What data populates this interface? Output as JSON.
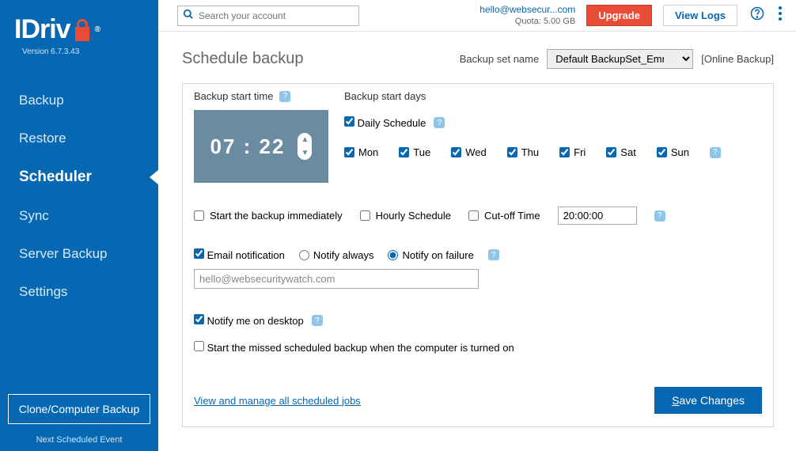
{
  "app": {
    "name": "IDrive",
    "version": "Version  6.7.3.43"
  },
  "sidebar": {
    "items": [
      "Backup",
      "Restore",
      "Scheduler",
      "Sync",
      "Server Backup",
      "Settings"
    ],
    "active_index": 2,
    "clone_label": "Clone/Computer Backup",
    "next_event_label": "Next Scheduled Event"
  },
  "topbar": {
    "search_placeholder": "Search your account",
    "account_email": "hello@websecur...com",
    "quota": "Quota: 5.00 GB",
    "upgrade_label": "Upgrade",
    "viewlogs_label": "View Logs"
  },
  "page": {
    "title": "Schedule backup",
    "set_label": "Backup set name",
    "set_value": "Default BackupSet_Emma",
    "online_label": "[Online Backup]"
  },
  "scheduler": {
    "start_time_label": "Backup start time",
    "start_days_label": "Backup start days",
    "time_hh": "07",
    "time_mm": "22",
    "daily_label": "Daily Schedule",
    "daily_checked": true,
    "days": [
      "Mon",
      "Tue",
      "Wed",
      "Thu",
      "Fri",
      "Sat",
      "Sun"
    ],
    "days_checked": [
      true,
      true,
      true,
      true,
      true,
      true,
      true
    ]
  },
  "options": {
    "start_immediately": {
      "label": "Start the backup immediately",
      "checked": false
    },
    "hourly": {
      "label": "Hourly Schedule",
      "checked": false
    },
    "cutoff": {
      "label": "Cut-off Time",
      "checked": false,
      "value": "20:00:00"
    }
  },
  "email": {
    "notify_label": "Email notification",
    "notify_checked": true,
    "always_label": "Notify always",
    "failure_label": "Notify on failure",
    "mode": "failure",
    "address": "hello@websecuritywatch.com"
  },
  "desktop": {
    "label": "Notify me on desktop",
    "checked": true
  },
  "missed": {
    "label": "Start the missed scheduled backup when the computer is turned on",
    "checked": false
  },
  "footer": {
    "view_link": "View and manage all scheduled jobs",
    "save_label_pre": "S",
    "save_label_rest": "ave Changes"
  }
}
